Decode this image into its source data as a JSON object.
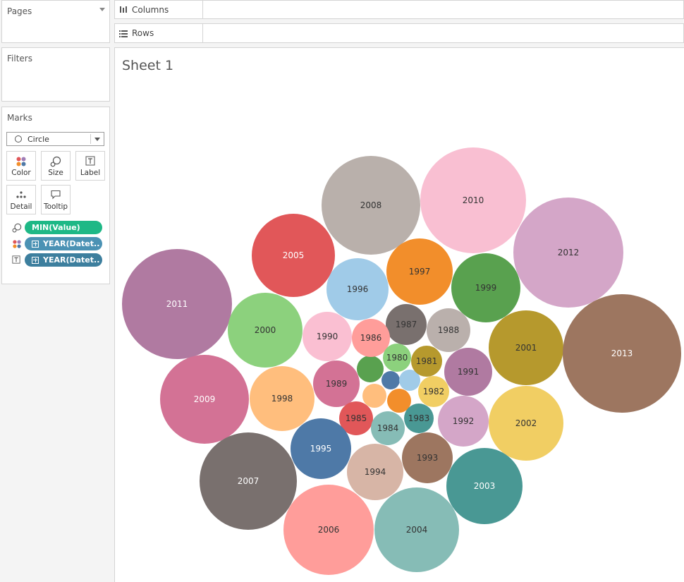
{
  "shelves": {
    "columns": "Columns",
    "rows": "Rows"
  },
  "cards": {
    "pages": "Pages",
    "filters": "Filters",
    "marks": "Marks",
    "mark_type": "Circle",
    "buttons": {
      "color": "Color",
      "size": "Size",
      "label": "Label",
      "detail": "Detail",
      "tooltip": "Tooltip"
    },
    "pills": [
      {
        "role": "size",
        "text": "MIN(Value)",
        "color": "#1eb886"
      },
      {
        "role": "color",
        "text": "YEAR(Datet..",
        "color": "#4b92b4"
      },
      {
        "role": "label",
        "text": "YEAR(Datet..",
        "color": "#3d7f9e"
      }
    ]
  },
  "sheet": {
    "title": "Sheet 1"
  },
  "chart_data": {
    "type": "packed-bubble",
    "labels": [
      "2008",
      "2010",
      "2005",
      "2012",
      "1997",
      "1996",
      "1999",
      "2011",
      "2000",
      "1987",
      "1988",
      "1990",
      "1986",
      "2001",
      "2013",
      "1980",
      "1981",
      "1991",
      "1989",
      "2009",
      "1998",
      "1982",
      "1985",
      "1983",
      "1992",
      "2002",
      "1984",
      "1995",
      "1993",
      "1994",
      "2007",
      "2003",
      "2006",
      "2004"
    ],
    "colors": [
      "#b9b0ab",
      "#f9bfd2",
      "#e15759",
      "#d4a6c8",
      "#f28e2b",
      "#a0cbe8",
      "#59a14f",
      "#b07aa1",
      "#8cd17d",
      "#79706e",
      "#bab0ac",
      "#fabfd2",
      "#ff9d9a",
      "#b6992d",
      "#9d7660",
      "#8cd17d",
      "#b6992d",
      "#b07aa1",
      "#d37295",
      "#d37295",
      "#ffbe7d",
      "#f1ce63",
      "#e15759",
      "#499894",
      "#d4a6c8",
      "#f1ce63",
      "#86bcb6",
      "#4e79a7",
      "#9d7660",
      "#d7b5a6",
      "#79706e",
      "#499894",
      "#ff9d9a",
      "#86bcb6"
    ],
    "white_text": [
      "2005",
      "2011",
      "2013",
      "2009",
      "1995",
      "2007",
      "2003"
    ],
    "unlabeled": [
      {
        "color": "#59a14f"
      },
      {
        "color": "#4e79a7"
      },
      {
        "color": "#a0cbe8"
      },
      {
        "color": "#ffbe7d"
      },
      {
        "color": "#f28e2b"
      }
    ]
  }
}
